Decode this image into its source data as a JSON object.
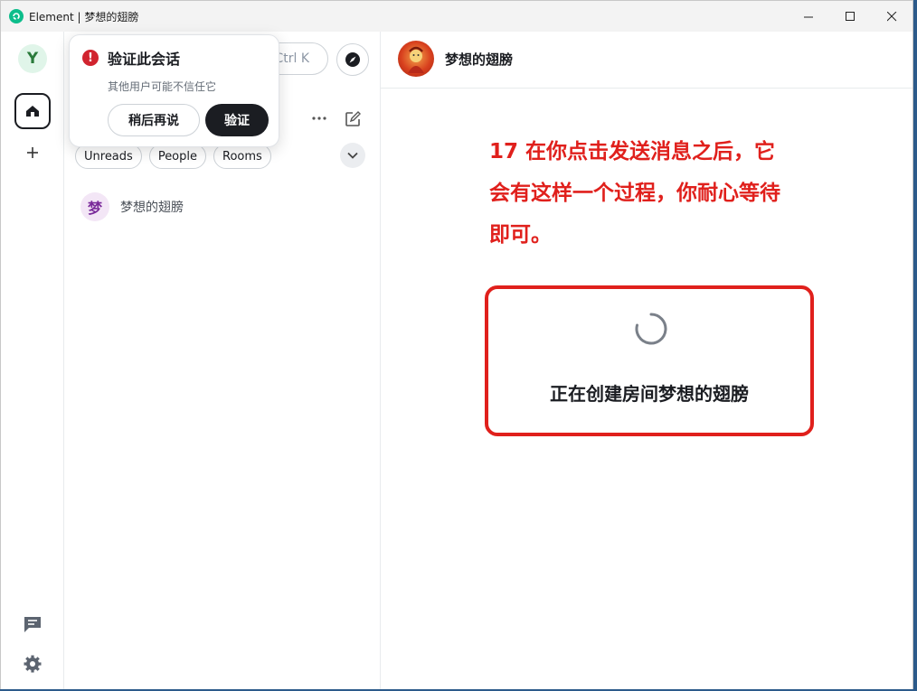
{
  "window": {
    "title": "Element | 梦想的翅膀",
    "app_logo": "element-logo"
  },
  "spaces": {
    "user_initial": "Y",
    "icons": [
      "home-icon",
      "plus-icon",
      "threads-icon",
      "settings-icon"
    ]
  },
  "roomlist": {
    "search_shortcut": "Ctrl K",
    "filters": [
      "Unreads",
      "People",
      "Rooms"
    ],
    "rooms": [
      {
        "initial": "梦",
        "name": "梦想的翅膀"
      }
    ]
  },
  "popup": {
    "title": "验证此会话",
    "subtitle": "其他用户可能不信任它",
    "later_label": "稍后再说",
    "verify_label": "验证"
  },
  "main": {
    "room_name": "梦想的翅膀",
    "annotation_lines": [
      "17 在你点击发送消息之后，它",
      "会有这样一个过程，你耐心等待",
      "即可。"
    ],
    "creating_text": "正在创建房间梦想的翅膀",
    "annotation_color": "#e0201c"
  }
}
